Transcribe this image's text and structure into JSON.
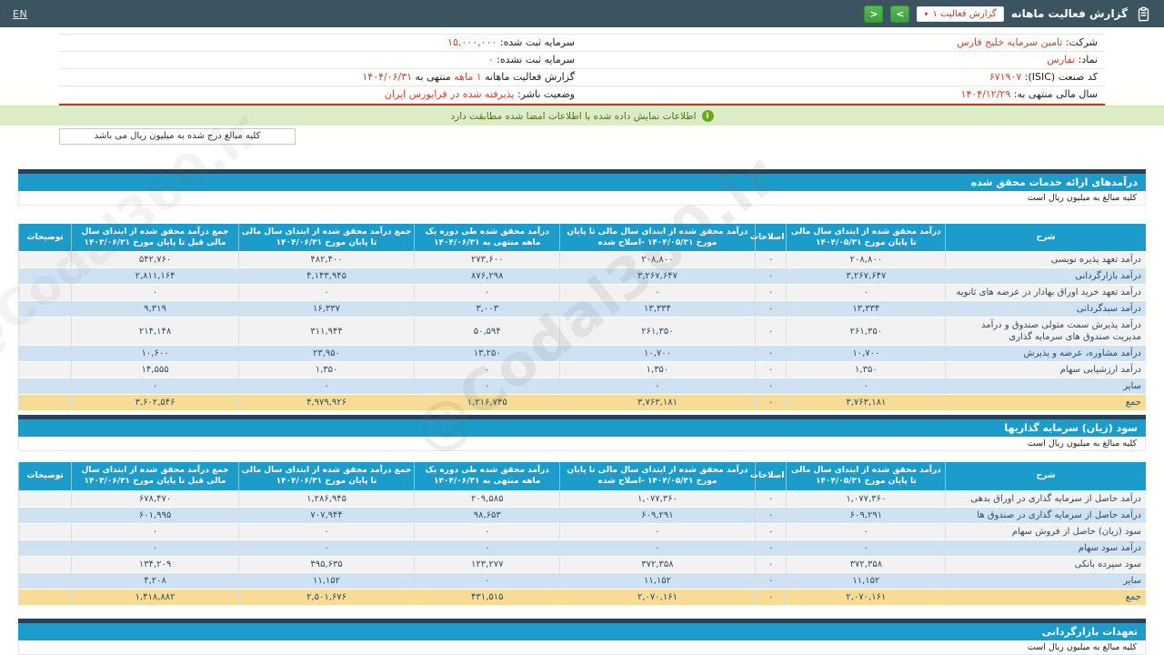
{
  "header": {
    "title": "گزارش فعالیت ماهانه",
    "dropdown_label": "گزارش فعالیت ۱",
    "dropdown_caret": "▾",
    "chevron_right": ">",
    "chevron_left": "<",
    "en_link": "EN"
  },
  "info": {
    "right_col": [
      {
        "parts": [
          {
            "text": "شرکت:  ",
            "red": false
          },
          {
            "text": "تامین سرمایه خلیج فارس",
            "red": true,
            "link": true
          }
        ]
      },
      {
        "parts": [
          {
            "text": "نماد:  ",
            "red": false
          },
          {
            "text": "تفارس",
            "red": true
          }
        ]
      },
      {
        "parts": [
          {
            "text": "کد صنعت (ISIC):  ",
            "red": false
          },
          {
            "text": "۶۷۱۹۰۷",
            "red": true
          }
        ]
      },
      {
        "parts": [
          {
            "text": "سال مالی منتهی به:  ",
            "red": false
          },
          {
            "text": "۱۴۰۴/۱۲/۲۹",
            "red": true
          }
        ]
      }
    ],
    "left_col": [
      {
        "parts": [
          {
            "text": "سرمایه ثبت شده:  ",
            "red": false
          },
          {
            "text": "۱۵,۰۰۰,۰۰۰",
            "red": true
          }
        ]
      },
      {
        "parts": [
          {
            "text": "سرمایه ثبت نشده:  ",
            "red": false
          },
          {
            "text": "۰",
            "red": true
          }
        ]
      },
      {
        "parts": [
          {
            "text": "گزارش فعالیت ماهانه ",
            "red": false
          },
          {
            "text": "۱ ماهه",
            "red": true
          },
          {
            "text": " منتهی به ",
            "red": false
          },
          {
            "text": "۱۴۰۴/۰۶/۳۱",
            "red": true
          }
        ]
      },
      {
        "parts": [
          {
            "text": "وضعیت ناشر:  ",
            "red": false
          },
          {
            "text": "پذیرفته شده در فرابورس ایران",
            "red": true
          }
        ]
      }
    ]
  },
  "notice": {
    "icon_char": "i",
    "text": "اطلاعات نمایش داده شده با اطلاعات امضا شده مطابقت دارد"
  },
  "amount_box_text": "کلیه مبالغ درج شده به میلیون ریال می باشد",
  "rial_note": "کلیه مبالغ به میلیون ریال است",
  "watermark_text": "@Codal360.ir",
  "table1": {
    "section_title": "درآمدهای ارائه خدمات محقق شده",
    "col_widths": [
      "17.8%",
      "14.1%",
      "2.8%",
      "17.3%",
      "12.9%",
      "15.6%",
      "14.8%",
      "4.7%"
    ],
    "amber_columns": [
      3,
      5
    ],
    "headers": [
      "شرح",
      "درآمد محقق شده از ابتدای سال مالی تا پایان مورخ ۱۴۰۴/۰۵/۳۱",
      "اصلاحات",
      "درآمد محقق شده از ابتدای سال مالی تا پایان مورخ ۱۴۰۴/۰۵/۳۱ -اصلاح شده",
      "درآمد محقق شده طی دوره یک ماهه منتهی به ۱۴۰۴/۰۶/۳۱",
      "جمع درآمد محقق شده از ابتدای سال مالی تا پایان مورخ ۱۴۰۴/۰۶/۳۱",
      "جمع درآمد محقق شده از ابتدای سال مالی قبل تا پایان مورخ ۱۴۰۳/۰۶/۳۱",
      "توضیحات"
    ],
    "rows": [
      {
        "cells": [
          "درآمد تعهد پذیره نویسی",
          "۲۰۸,۸۰۰",
          "۰",
          "۲۰۸,۸۰۰",
          "۲۷۳,۶۰۰",
          "۴۸۲,۴۰۰",
          "۵۴۲,۷۶۰",
          ""
        ],
        "is_total": false
      },
      {
        "cells": [
          "درآمد بازارگردانی",
          "۳,۲۶۷,۶۴۷",
          "۰",
          "۳,۲۶۷,۶۴۷",
          "۸۷۶,۲۹۸",
          "۴,۱۴۳,۹۴۵",
          "۲,۸۱۱,۱۶۴",
          ""
        ],
        "is_total": false
      },
      {
        "cells": [
          "درآمد تعهد خرید اوراق بهادار در عرضه های ثانویه",
          "۰",
          "۰",
          "۰",
          "۰",
          "۰",
          "۰",
          ""
        ],
        "is_total": false
      },
      {
        "cells": [
          "درآمد سبدگردانی",
          "۱۳,۳۳۴",
          "۰",
          "۱۳,۳۳۴",
          "۳,۰۰۳",
          "۱۶,۳۳۷",
          "۹,۳۱۹",
          ""
        ],
        "is_total": false
      },
      {
        "cells": [
          "درآمد پذیرش سمت متولی صندوق و درآمد مدیریت صندوق های سرمایه گذاری",
          "۲۶۱,۳۵۰",
          "۰",
          "۲۶۱,۳۵۰",
          "۵۰,۵۹۴",
          "۳۱۱,۹۴۴",
          "۲۱۴,۱۴۸",
          ""
        ],
        "is_total": false
      },
      {
        "cells": [
          "درآمد مشاوره، عرضه و پذیرش",
          "۱۰,۷۰۰",
          "۰",
          "۱۰,۷۰۰",
          "۱۳,۲۵۰",
          "۲۳,۹۵۰",
          "۱۰,۶۰۰",
          ""
        ],
        "is_total": false
      },
      {
        "cells": [
          "درآمد ارزشیابی سهام",
          "۱,۳۵۰",
          "۰",
          "۱,۳۵۰",
          "۰",
          "۱,۳۵۰",
          "۱۴,۵۵۵",
          ""
        ],
        "is_total": false
      },
      {
        "cells": [
          "سایر",
          "۰",
          "۰",
          "۰",
          "۰",
          "۰",
          "۰",
          ""
        ],
        "is_total": false
      },
      {
        "cells": [
          "جمع",
          "۳,۷۶۳,۱۸۱",
          "۰",
          "۳,۷۶۳,۱۸۱",
          "۱,۲۱۶,۷۴۵",
          "۴,۹۷۹,۹۲۶",
          "۳,۶۰۲,۵۴۶",
          ""
        ],
        "is_total": true
      }
    ]
  },
  "table2": {
    "section_title": "سود (زیان) سرمایه گذاریها",
    "col_widths": [
      "17.8%",
      "14.1%",
      "2.8%",
      "17.3%",
      "12.9%",
      "15.6%",
      "14.8%",
      "4.7%"
    ],
    "amber_columns": [
      3,
      5
    ],
    "headers": [
      "شرح",
      "درآمد محقق شده از ابتدای سال مالی تا پایان مورخ ۱۴۰۴/۰۵/۳۱",
      "اصلاحات",
      "درآمد محقق شده از ابتدای سال مالی تا پایان مورخ ۱۴۰۴/۰۵/۳۱ -اصلاح شده",
      "درآمد محقق شده طی دوره یک ماهه منتهی به ۱۴۰۴/۰۶/۳۱",
      "جمع درآمد محقق شده از ابتدای سال مالی تا پایان مورخ ۱۴۰۴/۰۶/۳۱",
      "جمع درآمد محقق شده از ابتدای سال مالی قبل تا پایان مورخ ۱۴۰۳/۰۶/۳۱",
      "توضیحات"
    ],
    "rows": [
      {
        "cells": [
          "درآمد حاصل از سرمایه گذاری در اوراق بدهی",
          "۱,۰۷۷,۳۶۰",
          "۰",
          "۱,۰۷۷,۳۶۰",
          "۲۰۹,۵۸۵",
          "۱,۲۸۶,۹۴۵",
          "۶۷۸,۴۷۰",
          ""
        ],
        "is_total": false
      },
      {
        "cells": [
          "درآمد حاصل از سرمایه گذاری در صندوق ها",
          "۶۰۹,۲۹۱",
          "۰",
          "۶۰۹,۲۹۱",
          "۹۸,۶۵۳",
          "۷۰۷,۹۴۴",
          "۶۰۱,۹۹۵",
          ""
        ],
        "is_total": false
      },
      {
        "cells": [
          "سود (زیان) حاصل از فروش سهام",
          "۰",
          "۰",
          "۰",
          "۰",
          "۰",
          "۰",
          ""
        ],
        "is_total": false
      },
      {
        "cells": [
          "درآمد سود سهام",
          "۰",
          "۰",
          "۰",
          "۰",
          "۰",
          "۰",
          ""
        ],
        "is_total": false
      },
      {
        "cells": [
          "سود سپرده بانکی",
          "۳۷۲,۳۵۸",
          "۰",
          "۳۷۲,۳۵۸",
          "۱۲۳,۲۷۷",
          "۴۹۵,۶۳۵",
          "۱۳۴,۲۰۹",
          ""
        ],
        "is_total": false
      },
      {
        "cells": [
          "سایر",
          "۱۱,۱۵۲",
          "۰",
          "۱۱,۱۵۲",
          "۰",
          "۱۱,۱۵۲",
          "۴,۲۰۸",
          ""
        ],
        "is_total": false
      },
      {
        "cells": [
          "جمع",
          "۲,۰۷۰,۱۶۱",
          "۰",
          "۲,۰۷۰,۱۶۱",
          "۴۳۱,۵۱۵",
          "۲,۵۰۱,۶۷۶",
          "۱,۴۱۸,۸۸۲",
          ""
        ],
        "is_total": true
      }
    ]
  },
  "section3": {
    "title": "تعهدات بازارگردانی"
  }
}
